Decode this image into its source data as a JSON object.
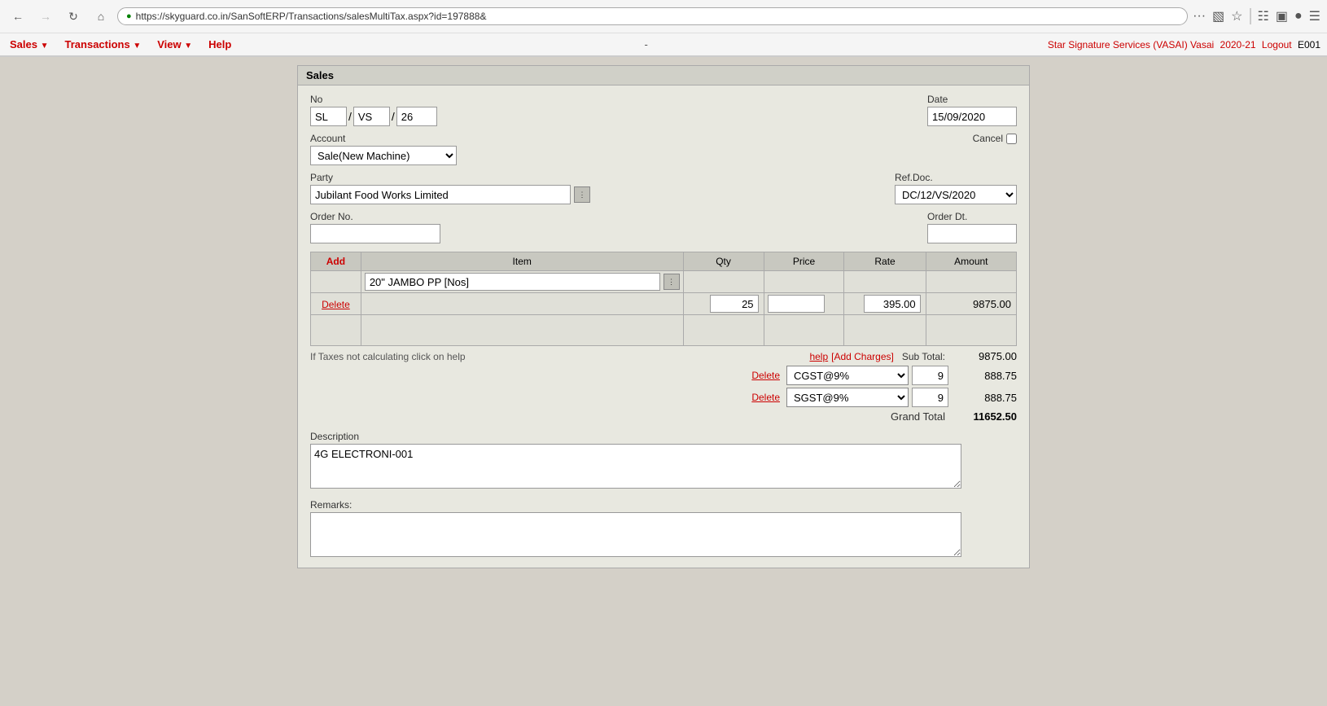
{
  "browser": {
    "url": "https://skyguard.co.in/SanSoftERP/Transactions/salesMultiTax.aspx?id=197888&",
    "back_disabled": false,
    "forward_disabled": false
  },
  "appMenu": {
    "items": [
      {
        "label": "Sales",
        "id": "sales"
      },
      {
        "label": "Transactions",
        "id": "transactions"
      },
      {
        "label": "View",
        "id": "view"
      },
      {
        "label": "Help",
        "id": "help"
      }
    ],
    "separator": "-",
    "rightInfo": "Star Signature Services (VASAI) Vasai",
    "year": "2020-21",
    "logout": "Logout",
    "user": "E001"
  },
  "form": {
    "title": "Sales",
    "noLabel": "No",
    "noPart1": "SL",
    "noPart2": "VS",
    "noPart3": "26",
    "dateLabel": "Date",
    "dateValue": "15/09/2020",
    "accountLabel": "Account",
    "accountValue": "Sale(New Machine)",
    "cancelLabel": "Cancel",
    "partyLabel": "Party",
    "partyValue": "Jubilant Food Works Limited",
    "refDocLabel": "Ref.Doc.",
    "refDocValue": "DC/12/VS/2020",
    "orderNoLabel": "Order No.",
    "orderNoValue": "",
    "orderDtLabel": "Order Dt.",
    "orderDtValue": "",
    "table": {
      "addLabel": "Add",
      "columns": [
        "Add",
        "Item",
        "Qty",
        "Price",
        "Rate",
        "Amount"
      ],
      "rows": [
        {
          "item": "20\" JAMBO PP [Nos]",
          "qty": "25",
          "price": "",
          "rate": "395.00",
          "amount": "9875.00"
        }
      ],
      "deleteLabel": "Delete"
    },
    "taxInfo": "If Taxes not calculating click on help",
    "helpLabel": "help",
    "addChargesLabel": "[Add Charges]",
    "subTotalLabel": "Sub Total:",
    "subTotalValue": "9875.00",
    "taxes": [
      {
        "deleteLabel": "Delete",
        "taxName": "CGST@9%",
        "rate": "9",
        "amount": "888.75"
      },
      {
        "deleteLabel": "Delete",
        "taxName": "SGST@9%",
        "rate": "9",
        "amount": "888.75"
      }
    ],
    "grandTotalLabel": "Grand Total",
    "grandTotalValue": "11652.50",
    "descriptionLabel": "Description",
    "descriptionValue": "4G ELECTRONI-001",
    "remarksLabel": "Remarks:",
    "remarksValue": ""
  }
}
